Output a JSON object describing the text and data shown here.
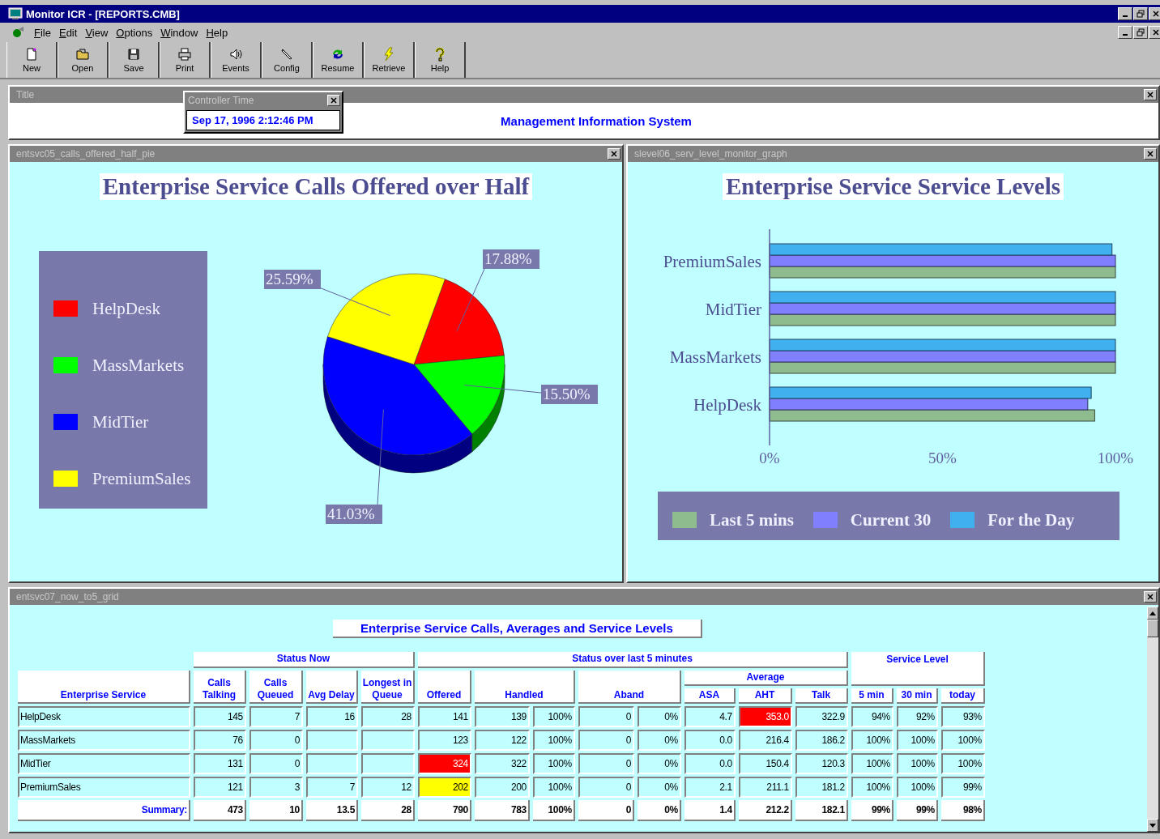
{
  "window": {
    "title": "Monitor ICR - [REPORTS.CMB]"
  },
  "menu": [
    "File",
    "Edit",
    "View",
    "Options",
    "Window",
    "Help"
  ],
  "toolbar": [
    {
      "label": "New",
      "kind": "new"
    },
    {
      "label": "Open",
      "kind": "open"
    },
    {
      "label": "Save",
      "kind": "save"
    },
    {
      "label": "Print",
      "kind": "print"
    },
    {
      "label": "Events",
      "kind": "events"
    },
    {
      "label": "Config",
      "kind": "config"
    },
    {
      "label": "Resume",
      "kind": "resume"
    },
    {
      "label": "Retrieve",
      "kind": "retrieve"
    },
    {
      "label": "Help",
      "kind": "help"
    }
  ],
  "title_panel": {
    "caption": "Title",
    "heading": "Management Information System"
  },
  "controller_time": {
    "caption": "Controller Time",
    "value": "Sep 17, 1996 2:12:46 PM"
  },
  "pie_panel": {
    "caption": "entsvc05_calls_offered_half_pie",
    "chart_data": {
      "type": "pie",
      "title": "Enterprise Service Calls Offered over Half",
      "categories": [
        "HelpDesk",
        "MassMarkets",
        "MidTier",
        "PremiumSales"
      ],
      "values": [
        17.88,
        15.5,
        41.03,
        25.59
      ],
      "colors": [
        "#ff0000",
        "#00ff00",
        "#0000ff",
        "#ffff00"
      ],
      "value_labels": [
        "17.88%",
        "15.50%",
        "41.03%",
        "25.59%"
      ]
    }
  },
  "bar_panel": {
    "caption": "slevel06_serv_level_monitor_graph",
    "chart_data": {
      "type": "bar",
      "orientation": "horizontal",
      "title": "Enterprise Service Service Levels",
      "categories": [
        "PremiumSales",
        "MidTier",
        "MassMarkets",
        "HelpDesk"
      ],
      "series": [
        {
          "name": "Last 5 mins",
          "color": "#8fbc8f",
          "values": [
            100,
            100,
            100,
            94
          ]
        },
        {
          "name": "Current 30",
          "color": "#8080ff",
          "values": [
            100,
            100,
            100,
            92
          ]
        },
        {
          "name": "For the Day",
          "color": "#40b0ee",
          "values": [
            99,
            100,
            100,
            93
          ]
        }
      ],
      "xlim": [
        0,
        100
      ],
      "xticks": [
        {
          "value": 0,
          "label": "0%"
        },
        {
          "value": 50,
          "label": "50%"
        },
        {
          "value": 100,
          "label": "100%"
        }
      ]
    }
  },
  "grid_panel": {
    "caption": "entsvc07_now_to5_grid",
    "title": "Enterprise Service Calls, Averages and Service Levels",
    "group_headers": [
      "Status Now",
      "Status over last 5 minutes",
      "Service Level"
    ],
    "subgroup_header": "Average",
    "columns": [
      "Enterprise Service",
      "Calls Talking",
      "Calls Queued",
      "Avg Delay",
      "Longest in Queue",
      "Offered",
      "Handled",
      null,
      "Aband",
      null,
      "ASA",
      "AHT",
      "Talk",
      "5 min",
      "30 min",
      "today"
    ],
    "rows": [
      {
        "cells": [
          "HelpDesk",
          "145",
          "7",
          "16",
          "28",
          "141",
          "139",
          "100%",
          "0",
          "0%",
          "4.7",
          {
            "text": "353.0",
            "color": "#ff0000"
          },
          "322.9",
          "94%",
          "92%",
          "93%"
        ]
      },
      {
        "cells": [
          "MassMarkets",
          "76",
          "0",
          null,
          null,
          "123",
          "122",
          "100%",
          "0",
          "0%",
          "0.0",
          "216.4",
          "186.2",
          "100%",
          "100%",
          "100%"
        ]
      },
      {
        "cells": [
          "MidTier",
          "131",
          "0",
          null,
          null,
          {
            "text": "324",
            "color": "#ff0000"
          },
          "322",
          "100%",
          "0",
          "0%",
          "0.0",
          "150.4",
          "120.3",
          "100%",
          "100%",
          "100%"
        ]
      },
      {
        "cells": [
          "PremiumSales",
          "121",
          "3",
          "7",
          "12",
          {
            "text": "202",
            "color": "#ffff00"
          },
          "200",
          "100%",
          "0",
          "0%",
          "2.1",
          "211.1",
          "181.2",
          "100%",
          "100%",
          "99%"
        ]
      }
    ],
    "summary": {
      "cells": [
        "Summary:",
        "473",
        "10",
        "13.5",
        "28",
        "790",
        "783",
        "100%",
        "0",
        "0%",
        "1.4",
        "212.2",
        "182.1",
        "99%",
        "99%",
        "98%"
      ]
    }
  }
}
